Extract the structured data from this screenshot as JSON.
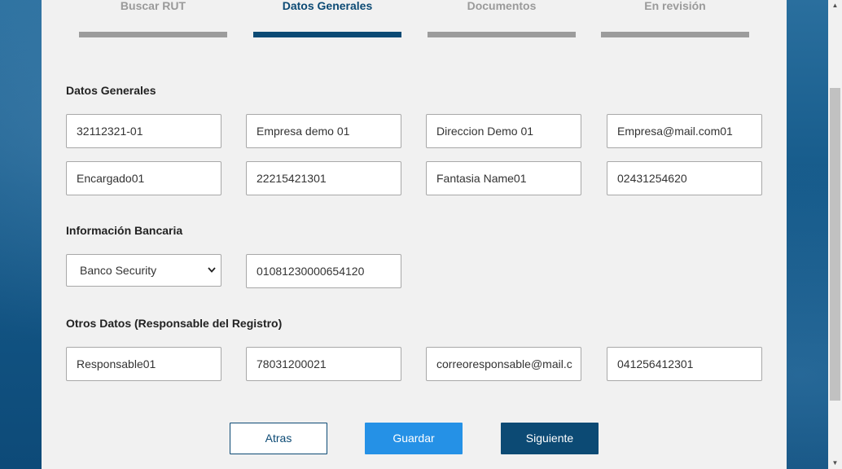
{
  "steps": [
    {
      "label": "Buscar RUT",
      "active": false
    },
    {
      "label": "Datos Generales",
      "active": true
    },
    {
      "label": "Documentos",
      "active": false
    },
    {
      "label": "En revisión",
      "active": false
    }
  ],
  "sections": {
    "general": {
      "title": "Datos Generales",
      "fields": [
        "32112321-01",
        "Empresa demo 01",
        "Direccion Demo 01",
        "Empresa@mail.com01",
        "Encargado01",
        "22215421301",
        "Fantasia Name01",
        "02431254620"
      ]
    },
    "bank": {
      "title": "Información Bancaria",
      "bank_select": "Banco Security",
      "account": "01081230000654120"
    },
    "other": {
      "title": "Otros Datos (Responsable del Registro)",
      "fields": [
        "Responsable01",
        "78031200021",
        "correoresponsable@mail.c",
        "041256412301"
      ]
    }
  },
  "buttons": {
    "back": "Atras",
    "save": "Guardar",
    "next": "Siguiente"
  },
  "colors": {
    "primary": "#0c4a74",
    "accent": "#2591e6",
    "inactive": "#9c9c9c"
  },
  "icons": {
    "select": "chevron-down-icon"
  }
}
